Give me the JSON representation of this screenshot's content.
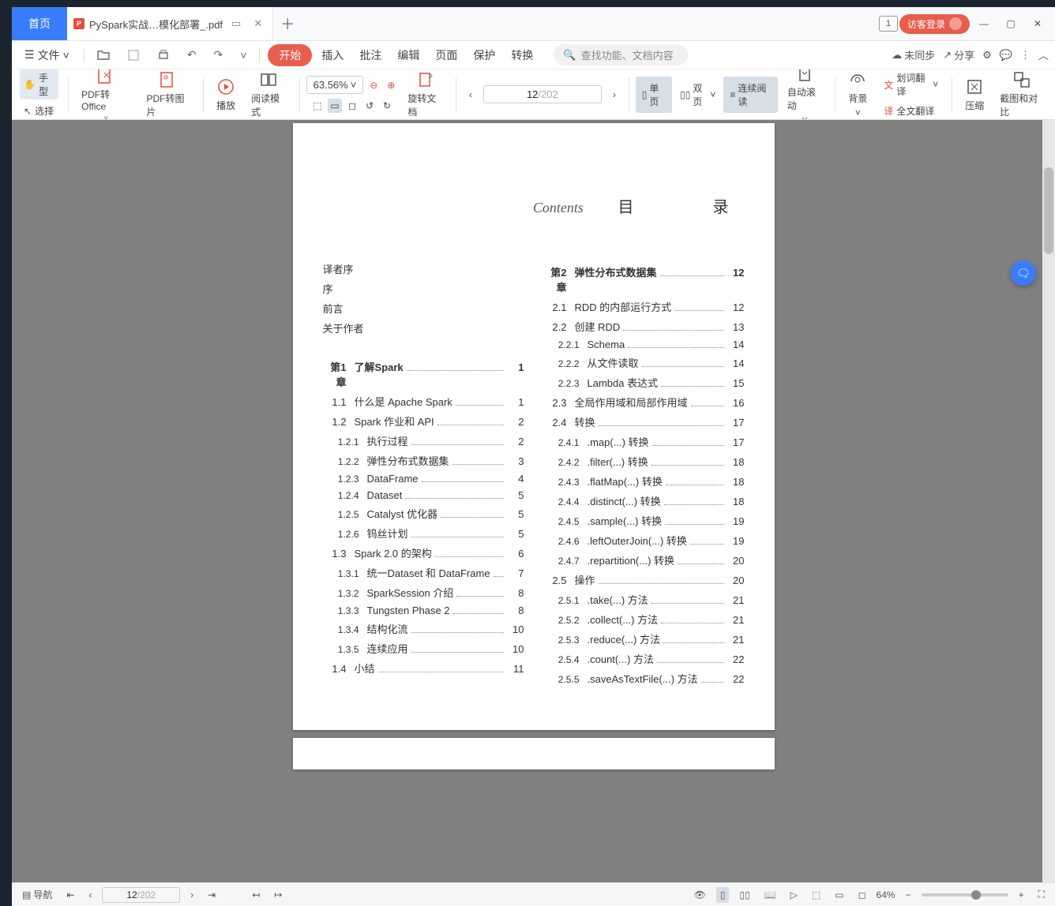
{
  "titlebar": {
    "home": "首页",
    "doc_title": "PySpark实战…模化部署_.pdf",
    "badge": "1",
    "guest": "访客登录"
  },
  "menubar": {
    "file": "文件",
    "items": [
      "开始",
      "插入",
      "批注",
      "编辑",
      "页面",
      "保护",
      "转换"
    ],
    "search_placeholder": "查找功能、文档内容",
    "sync": "未同步",
    "share": "分享"
  },
  "toolbar": {
    "hand": "手型",
    "select": "选择",
    "pdf_office": "PDF转Office",
    "pdf_img": "PDF转图片",
    "play": "播放",
    "read_mode": "阅读模式",
    "zoom": "63.56%",
    "rotate": "旋转文档",
    "page_current": "12",
    "page_total": "/202",
    "single": "单页",
    "double": "双页",
    "continuous": "连续阅读",
    "auto_scroll": "自动滚动",
    "background": "背景",
    "word_trans": "划词翻译",
    "full_trans": "全文翻译",
    "compress": "压缩",
    "crop_compare": "截图和对比"
  },
  "statusbar": {
    "nav": "导航",
    "page_current": "12",
    "page_total": "/202",
    "zoom": "64%"
  },
  "doc": {
    "contents_script": "Contents",
    "contents_label": "目　　录",
    "front": [
      "译者序",
      "序",
      "前言",
      "关于作者"
    ],
    "left": [
      {
        "type": "chap",
        "num": "第1章",
        "txt": "了解Spark",
        "pg": "1"
      },
      {
        "num": "1.1",
        "txt": "什么是 Apache Spark",
        "pg": "1"
      },
      {
        "num": "1.2",
        "txt": "Spark 作业和 API",
        "pg": "2"
      },
      {
        "sub": true,
        "num": "1.2.1",
        "txt": "执行过程",
        "pg": "2"
      },
      {
        "sub": true,
        "num": "1.2.2",
        "txt": "弹性分布式数据集",
        "pg": "3"
      },
      {
        "sub": true,
        "num": "1.2.3",
        "txt": "DataFrame",
        "pg": "4"
      },
      {
        "sub": true,
        "num": "1.2.4",
        "txt": "Dataset",
        "pg": "5"
      },
      {
        "sub": true,
        "num": "1.2.5",
        "txt": "Catalyst 优化器",
        "pg": "5"
      },
      {
        "sub": true,
        "num": "1.2.6",
        "txt": "钨丝计划",
        "pg": "5"
      },
      {
        "num": "1.3",
        "txt": "Spark 2.0 的架构",
        "pg": "6"
      },
      {
        "sub": true,
        "num": "1.3.1",
        "txt": "统一Dataset 和 DataFrame",
        "pg": "7"
      },
      {
        "sub": true,
        "num": "1.3.2",
        "txt": "SparkSession 介绍",
        "pg": "8"
      },
      {
        "sub": true,
        "num": "1.3.3",
        "txt": "Tungsten Phase 2",
        "pg": "8"
      },
      {
        "sub": true,
        "num": "1.3.4",
        "txt": "结构化流",
        "pg": "10"
      },
      {
        "sub": true,
        "num": "1.3.5",
        "txt": "连续应用",
        "pg": "10"
      },
      {
        "num": "1.4",
        "txt": "小结",
        "pg": "11"
      }
    ],
    "right": [
      {
        "type": "chap",
        "num": "第2章",
        "txt": "弹性分布式数据集",
        "pg": "12"
      },
      {
        "num": "2.1",
        "txt": "RDD 的内部运行方式",
        "pg": "12"
      },
      {
        "num": "2.2",
        "txt": "创建 RDD",
        "pg": "13"
      },
      {
        "sub": true,
        "num": "2.2.1",
        "txt": "Schema",
        "pg": "14"
      },
      {
        "sub": true,
        "num": "2.2.2",
        "txt": "从文件读取",
        "pg": "14"
      },
      {
        "sub": true,
        "num": "2.2.3",
        "txt": "Lambda 表达式",
        "pg": "15"
      },
      {
        "num": "2.3",
        "txt": "全局作用域和局部作用域",
        "pg": "16"
      },
      {
        "num": "2.4",
        "txt": "转换",
        "pg": "17"
      },
      {
        "sub": true,
        "num": "2.4.1",
        "txt": ".map(...) 转换",
        "pg": "17"
      },
      {
        "sub": true,
        "num": "2.4.2",
        "txt": ".filter(...) 转换",
        "pg": "18"
      },
      {
        "sub": true,
        "num": "2.4.3",
        "txt": ".flatMap(...) 转换",
        "pg": "18"
      },
      {
        "sub": true,
        "num": "2.4.4",
        "txt": ".distinct(...) 转换",
        "pg": "18"
      },
      {
        "sub": true,
        "num": "2.4.5",
        "txt": ".sample(...) 转换",
        "pg": "19"
      },
      {
        "sub": true,
        "num": "2.4.6",
        "txt": ".leftOuterJoin(...) 转换",
        "pg": "19"
      },
      {
        "sub": true,
        "num": "2.4.7",
        "txt": ".repartition(...) 转换",
        "pg": "20"
      },
      {
        "num": "2.5",
        "txt": "操作",
        "pg": "20"
      },
      {
        "sub": true,
        "num": "2.5.1",
        "txt": ".take(...) 方法",
        "pg": "21"
      },
      {
        "sub": true,
        "num": "2.5.2",
        "txt": ".collect(...) 方法",
        "pg": "21"
      },
      {
        "sub": true,
        "num": "2.5.3",
        "txt": ".reduce(...) 方法",
        "pg": "21"
      },
      {
        "sub": true,
        "num": "2.5.4",
        "txt": ".count(...) 方法",
        "pg": "22"
      },
      {
        "sub": true,
        "num": "2.5.5",
        "txt": ".saveAsTextFile(...) 方法",
        "pg": "22"
      }
    ]
  }
}
